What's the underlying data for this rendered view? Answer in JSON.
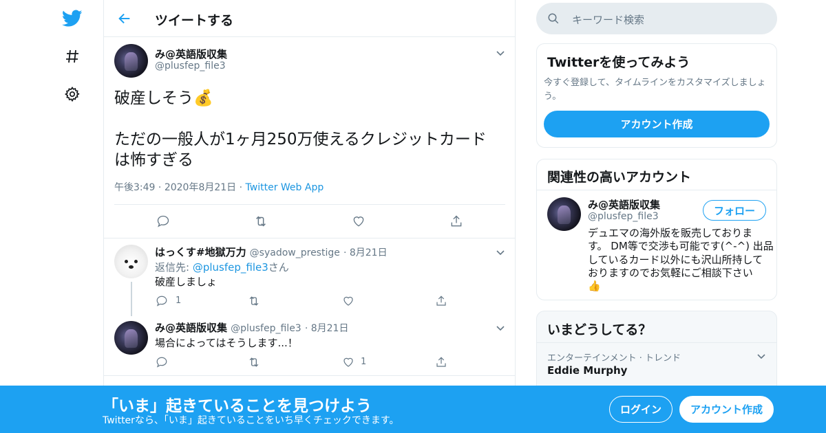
{
  "header": {
    "title": "ツイートする"
  },
  "tweet": {
    "name": "み@英語版収集",
    "handle": "@plusfep_file3",
    "line1": "破産しそう💰",
    "line2": "ただの一般人が1ヶ月250万使えるクレジットカード",
    "line3": "は怖すぎる",
    "time": "午後3:49",
    "date": "2020年8月21日",
    "source": "Twitter Web App"
  },
  "replies": [
    {
      "name": "はっくす#地獄万力",
      "handle": "@syadow_prestige",
      "date": "8月21日",
      "reply_to_prefix": "返信先: ",
      "reply_to": "@plusfep_file3",
      "reply_to_suffix": "さん",
      "text": "破産しましょ",
      "reply_count": "1",
      "like_count": ""
    },
    {
      "name": "み@英語版収集",
      "handle": "@plusfep_file3",
      "date": "8月21日",
      "text": "場合によってはそうします...！",
      "reply_count": "",
      "like_count": "1"
    }
  ],
  "sidebar": {
    "search_placeholder": "キーワード検索",
    "signup": {
      "title": "Twitterを使ってみよう",
      "desc1": "今すぐ登録して、タイムラインをカスタマイズしましょ",
      "desc2": "う。",
      "button": "アカウント作成"
    },
    "related": {
      "title": "関連性の高いアカウント",
      "name": "み@英語版収集",
      "handle": "@plusfep_file3",
      "follow": "フォロー",
      "bio1": "デュエマの海外版を販売しておりま",
      "bio2": "す。 DM等で交渉も可能です(^-^) 出品",
      "bio3": "しているカード以外にも沢山所持して",
      "bio4": "おりますのでお気軽にご相談下さい",
      "bio5": "👍"
    },
    "trends": {
      "title": "いまどうしてる？",
      "category": "エンターテインメント · トレンド",
      "topic": "Eddie Murphy"
    }
  },
  "banner": {
    "title": "「いま」起きていることを見つけよう",
    "subtitle": "Twitterなら、「いま」起きていることをいち早くチェックできます。",
    "login": "ログイン",
    "signup": "アカウント作成"
  },
  "colors": {
    "accent": "#1da1f2",
    "text": "#14171a",
    "muted": "#657786",
    "border": "#e6ecf0"
  }
}
